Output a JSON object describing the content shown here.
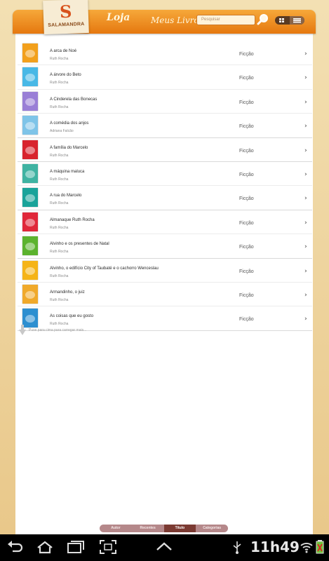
{
  "header": {
    "logo_text": "SALAMANDRA",
    "nav_loja": "Loja",
    "nav_meus_livros": "Meus Livros",
    "search_placeholder": "Pesquisar"
  },
  "books": [
    {
      "title": "A arca de Noé",
      "author": "Ruth Rocha",
      "category": "Ficção",
      "cover_color": "#f2a01c"
    },
    {
      "title": "A árvore do Beto",
      "author": "Ruth Rocha",
      "category": "Ficção",
      "cover_color": "#48b8e6"
    },
    {
      "title": "A Cinderela das Bonecas",
      "author": "Ruth Rocha",
      "category": "Ficção",
      "cover_color": "#9a7fd6"
    },
    {
      "title": "A comédia dos anjos",
      "author": "Adriana Falcão",
      "category": "Ficção",
      "cover_color": "#7ec4e8"
    },
    {
      "title": "A família do Marcelo",
      "author": "Ruth Rocha",
      "category": "Ficção",
      "cover_color": "#d8242e"
    },
    {
      "title": "A máquina maluca",
      "author": "Ruth Rocha",
      "category": "Ficção",
      "cover_color": "#3fb3a2"
    },
    {
      "title": "A rua do Marcelo",
      "author": "Ruth Rocha",
      "category": "Ficção",
      "cover_color": "#1aa39a"
    },
    {
      "title": "Almanaque Ruth Rocha",
      "author": "Ruth Rocha",
      "category": "Ficção",
      "cover_color": "#e0283a"
    },
    {
      "title": "Alvinho e os presentes de Natal",
      "author": "Ruth Rocha",
      "category": "Ficção",
      "cover_color": "#5cb32e"
    },
    {
      "title": "Alvinho, o edifício City of Taubaté e o cachorro Wenceslau",
      "author": "Ruth Rocha",
      "category": "Ficção",
      "cover_color": "#f5b418"
    },
    {
      "title": "Armandinho, o juiz",
      "author": "Ruth Rocha",
      "category": "Ficção",
      "cover_color": "#f0a92a"
    },
    {
      "title": "As coisas que eu gosto",
      "author": "Ruth Rocha",
      "category": "Ficção",
      "cover_color": "#2d8fd0"
    }
  ],
  "pull_to_refresh": "Puxe para cima para carregar mais...",
  "tabs": [
    {
      "label": "Autor",
      "active": false
    },
    {
      "label": "Recentes",
      "active": false
    },
    {
      "label": "Título",
      "active": true
    },
    {
      "label": "Categorias",
      "active": false
    }
  ],
  "system_bar": {
    "clock": "11h49"
  }
}
